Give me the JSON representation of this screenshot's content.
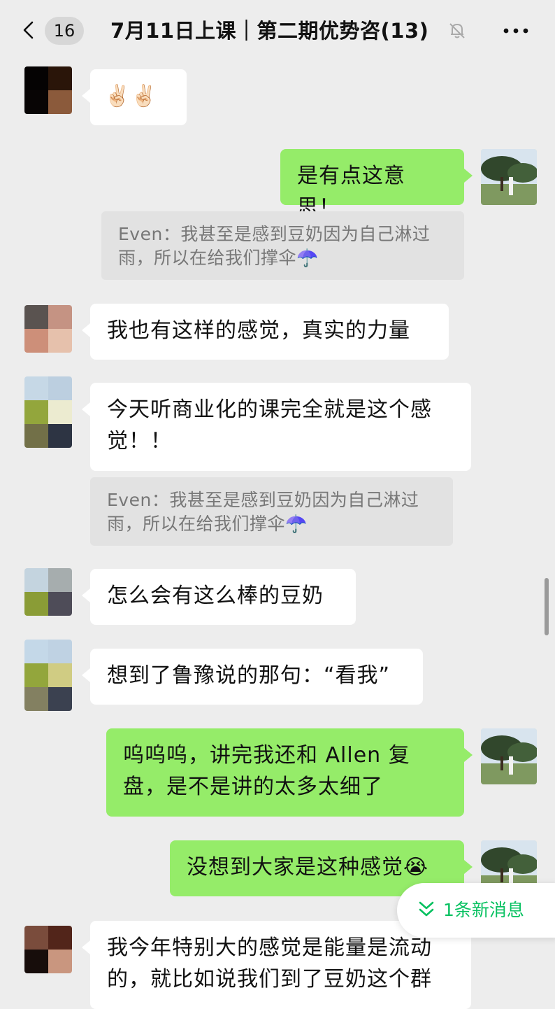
{
  "header": {
    "unread_count": "16",
    "title": "7月11日上课｜第二期优势咨(13)"
  },
  "messages": [
    {
      "side": "in",
      "text": "✌🏻✌🏻"
    },
    {
      "side": "out",
      "text": "是有点这意思！"
    },
    {
      "side": "quote",
      "text": "Even：我甚至是感到豆奶因为自己淋过雨，所以在给我们撑伞☂️"
    },
    {
      "side": "in",
      "text": "我也有这样的感觉，真实的力量"
    },
    {
      "side": "in",
      "text": "今天听商业化的课完全就是这个感觉！！"
    },
    {
      "side": "quote",
      "text": "Even：我甚至是感到豆奶因为自己淋过雨，所以在给我们撑伞☂️"
    },
    {
      "side": "in",
      "text": "怎么会有这么棒的豆奶"
    },
    {
      "side": "in",
      "text": "想到了鲁豫说的那句：“看我”"
    },
    {
      "side": "out",
      "text": "呜呜呜，讲完我还和 Allen 复盘，是不是讲的太多太细了"
    },
    {
      "side": "out",
      "text": "没想到大家是这种感觉😭"
    },
    {
      "side": "in",
      "text": "我今年特别大的感觉是能量是流动的，就比如说我们到了豆奶这个群"
    }
  ],
  "new_message_banner": "1条新消息",
  "colors": {
    "background": "#ededed",
    "outgoing_bubble": "#95ec69",
    "incoming_bubble": "#ffffff",
    "accent_green": "#07c160"
  }
}
